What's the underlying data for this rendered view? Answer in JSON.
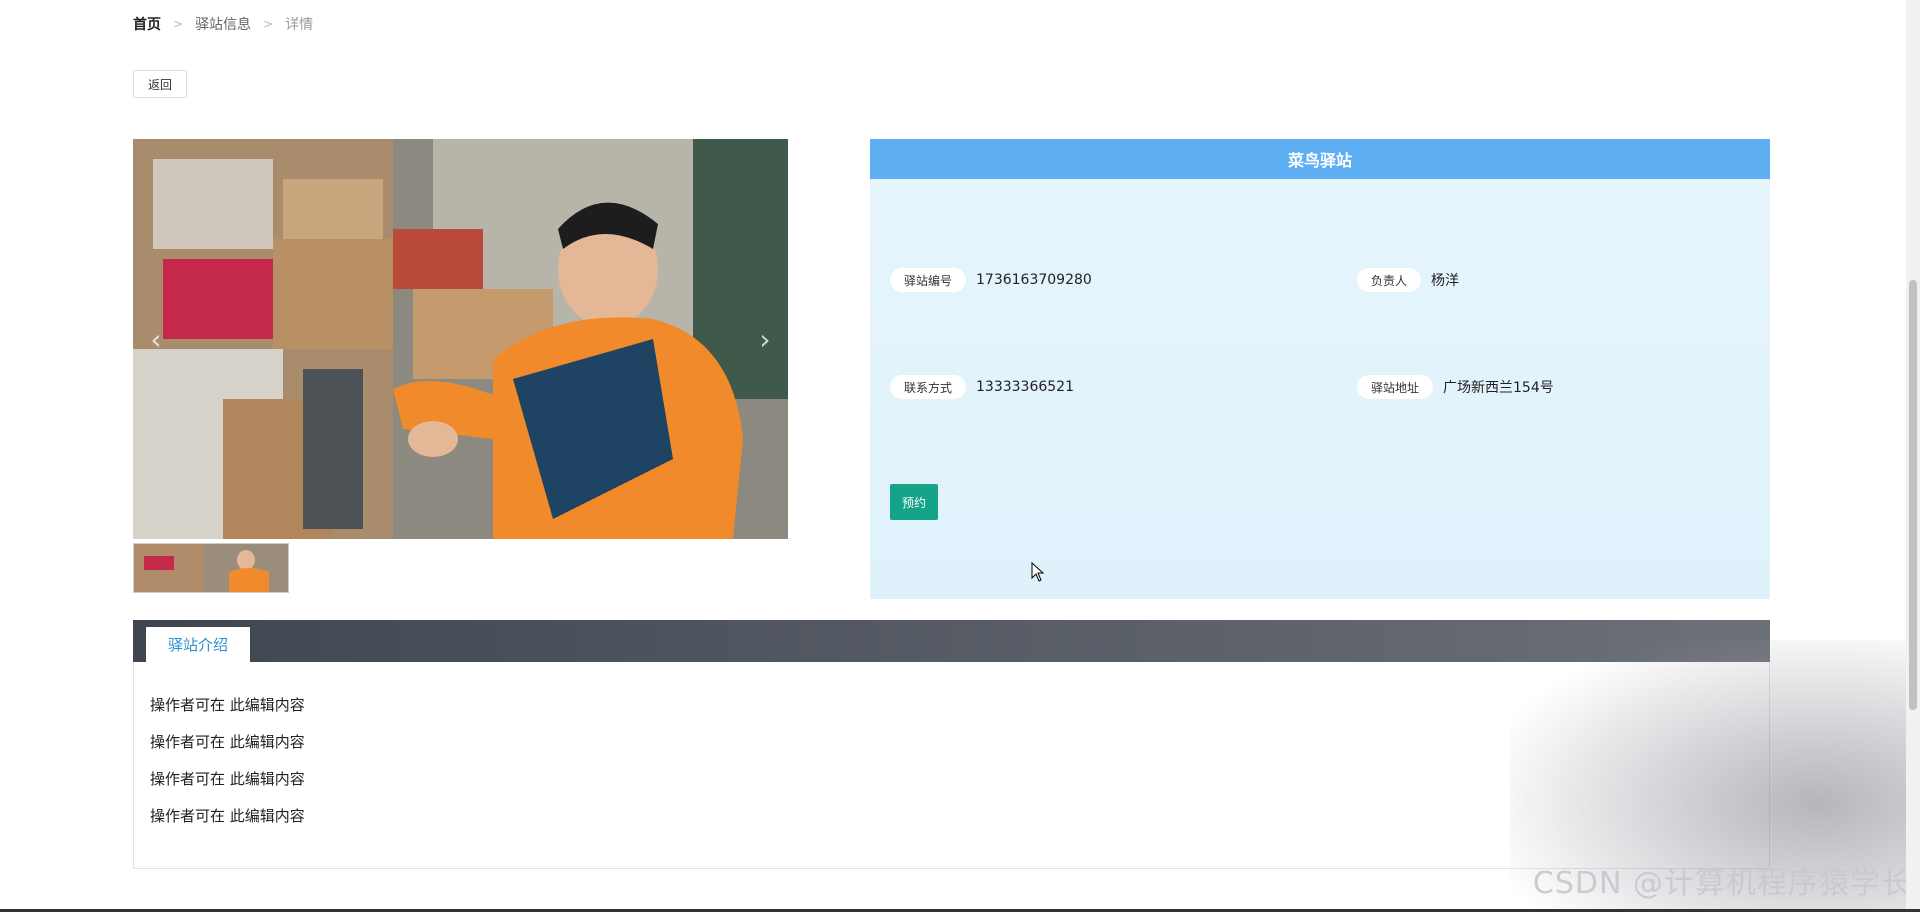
{
  "breadcrumb": {
    "home": "首页",
    "section": "驿站信息",
    "current": "详情",
    "separator": ">"
  },
  "actions": {
    "back_label": "返回",
    "book_label": "预约"
  },
  "gallery": {
    "prev_icon": "‹",
    "next_icon": "›",
    "thumbnail_count": 1
  },
  "station": {
    "title": "菜鸟驿站",
    "fields": [
      {
        "label": "驿站编号",
        "value": "1736163709280"
      },
      {
        "label": "负责人",
        "value": "杨洋"
      },
      {
        "label": "联系方式",
        "value": "13333366521"
      },
      {
        "label": "驿站地址",
        "value": "广场新西兰154号"
      }
    ]
  },
  "tabs": [
    {
      "label": "驿站介绍",
      "active": true
    }
  ],
  "intro": {
    "lines": [
      "操作者可在 此编辑内容",
      "操作者可在 此编辑内容",
      "操作者可在 此编辑内容",
      "操作者可在 此编辑内容"
    ]
  },
  "watermark": "CSDN @计算机程序猿学长",
  "colors": {
    "header_blue": "#5daef2",
    "book_green": "#15a38a",
    "tab_text": "#2b8fcf"
  }
}
